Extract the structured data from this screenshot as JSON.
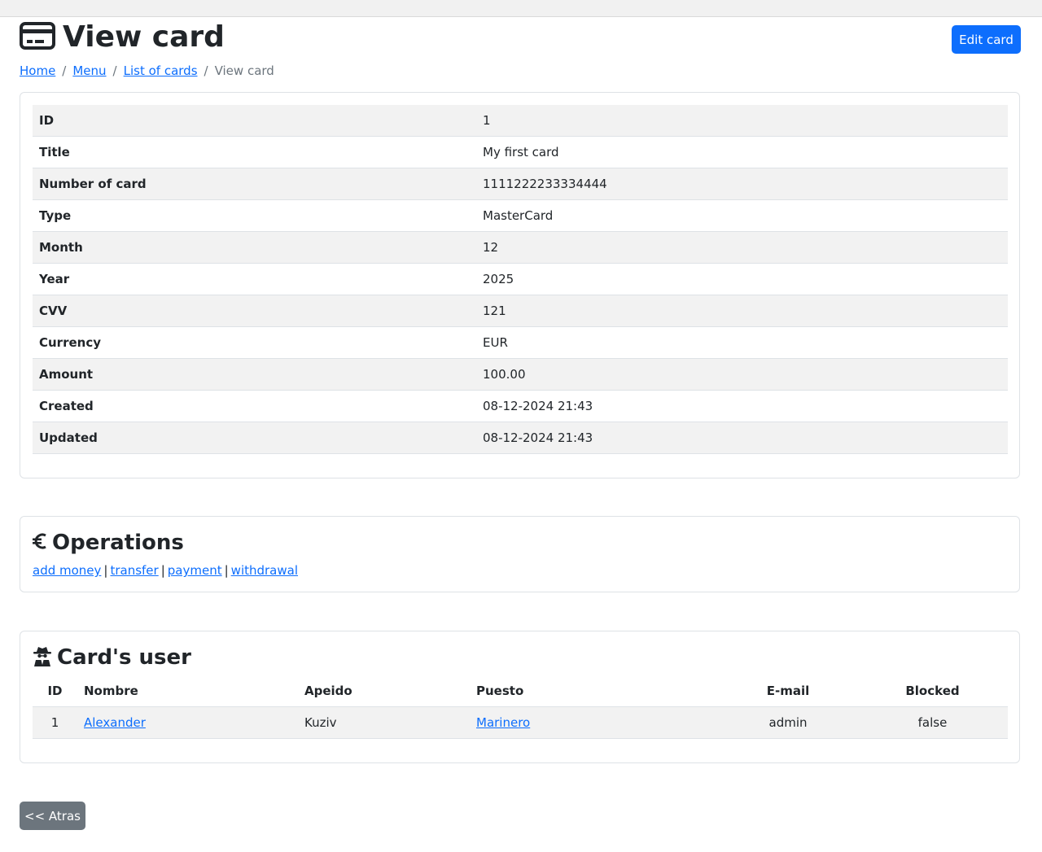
{
  "header": {
    "title": "View card",
    "title_icon": "credit-card-icon",
    "edit_button": "Edit card"
  },
  "breadcrumb": {
    "items": [
      "Home",
      "Menu",
      "List of cards"
    ],
    "current": "View card",
    "separator": "/"
  },
  "card_details": {
    "rows": [
      {
        "label": "ID",
        "value": "1"
      },
      {
        "label": "Title",
        "value": "My first card"
      },
      {
        "label": "Number of card",
        "value": "1111222233334444"
      },
      {
        "label": "Type",
        "value": "MasterCard"
      },
      {
        "label": "Month",
        "value": "12"
      },
      {
        "label": "Year",
        "value": "2025"
      },
      {
        "label": "CVV",
        "value": "121"
      },
      {
        "label": "Currency",
        "value": "EUR"
      },
      {
        "label": "Amount",
        "value": "100.00"
      },
      {
        "label": "Created",
        "value": "08-12-2024 21:43"
      },
      {
        "label": "Updated",
        "value": "08-12-2024 21:43"
      }
    ]
  },
  "operations": {
    "title": "Operations",
    "icon": "euro-icon",
    "links": [
      "add money",
      "transfer",
      "payment",
      "withdrawal"
    ],
    "separator": "|"
  },
  "card_user": {
    "title": "Card's user",
    "icon": "user-secret-icon",
    "columns": [
      "ID",
      "Nombre",
      "Apeido",
      "Puesto",
      "E-mail",
      "Blocked"
    ],
    "rows": [
      {
        "id": "1",
        "nombre": "Alexander",
        "apeido": "Kuziv",
        "puesto": "Marinero",
        "email": "admin",
        "blocked": "false"
      }
    ]
  },
  "footer": {
    "back_button": "<< Atras"
  },
  "colors": {
    "primary": "#0d6efd",
    "secondary": "#6c757d",
    "stripe": "#f2f2f2",
    "border": "#dee2e6"
  }
}
